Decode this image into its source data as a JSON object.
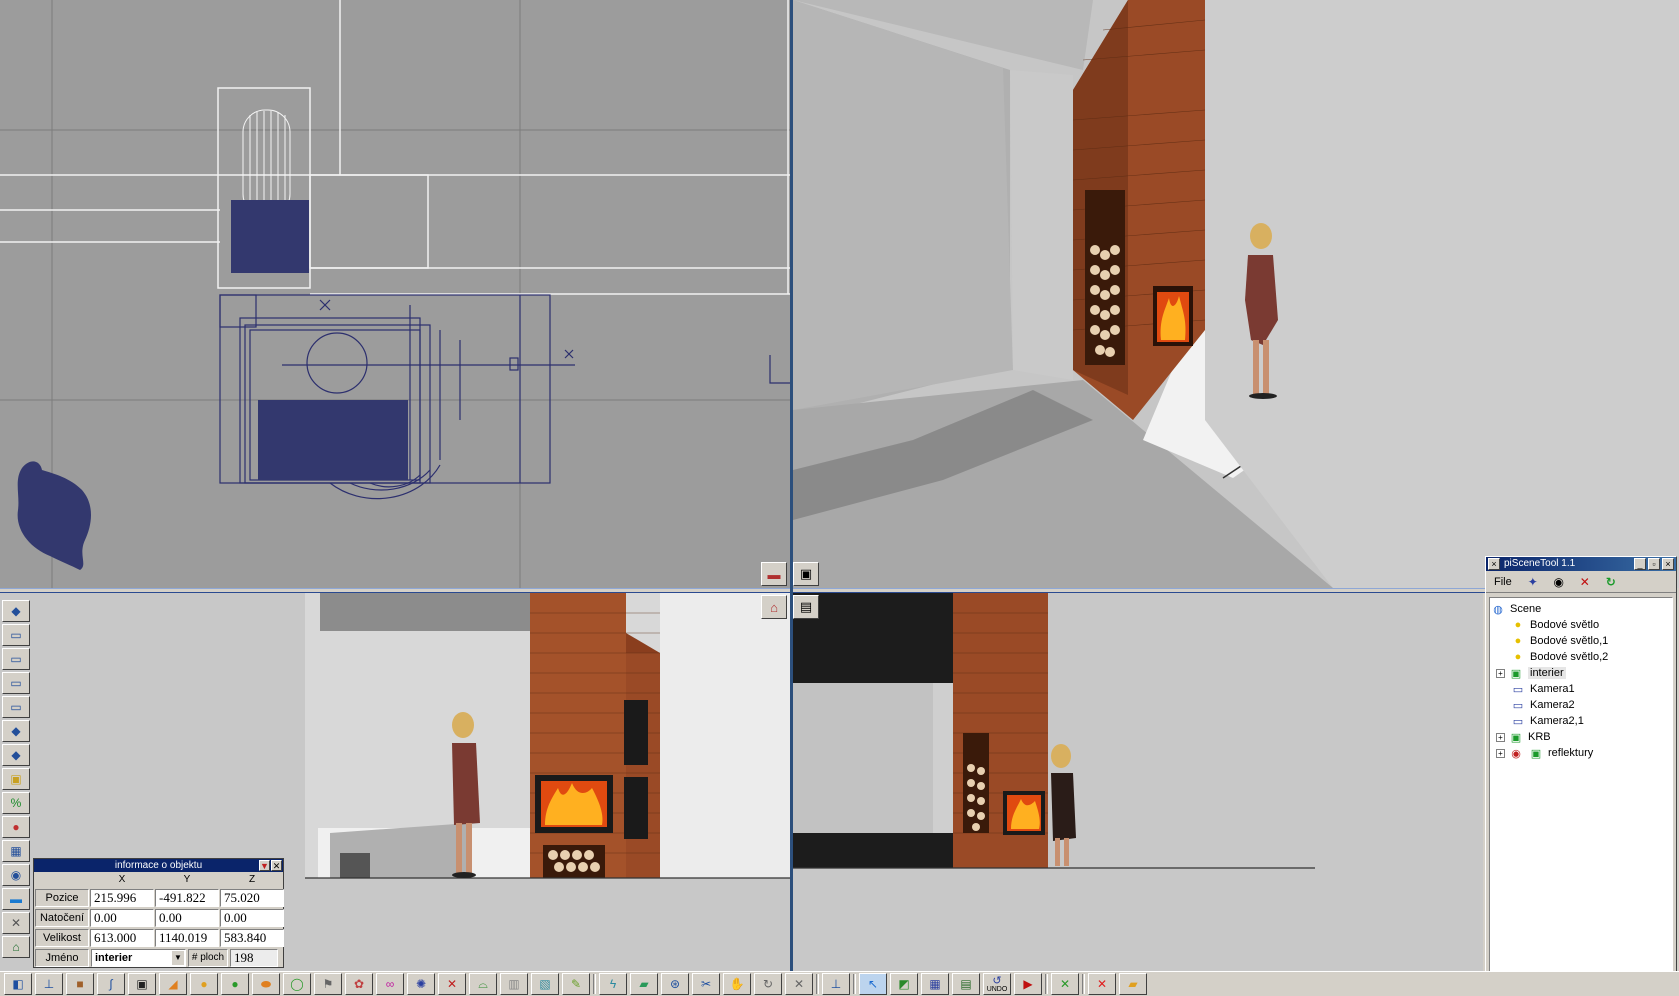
{
  "scene_tool": {
    "title": "piSceneTool 1.1",
    "close_left": "×",
    "minimize": "_",
    "restore": "▫",
    "close": "×",
    "file_menu": "File",
    "tree": [
      {
        "label": "Scene",
        "type": "scene",
        "level": 0,
        "expandable": false
      },
      {
        "label": "Bodové světlo",
        "type": "light",
        "level": 1,
        "expandable": false
      },
      {
        "label": "Bodové světlo,1",
        "type": "light",
        "level": 1,
        "expandable": false
      },
      {
        "label": "Bodové světlo,2",
        "type": "light",
        "level": 1,
        "expandable": false
      },
      {
        "label": "interier",
        "type": "group",
        "level": 1,
        "expandable": true,
        "selected": true
      },
      {
        "label": "Kamera1",
        "type": "camera",
        "level": 1,
        "expandable": false
      },
      {
        "label": "Kamera2",
        "type": "camera",
        "level": 1,
        "expandable": false
      },
      {
        "label": "Kamera2,1",
        "type": "camera",
        "level": 1,
        "expandable": false
      },
      {
        "label": "KRB",
        "type": "group",
        "level": 1,
        "expandable": true
      },
      {
        "label": "reflektury",
        "type": "group",
        "level": 1,
        "expandable": true
      }
    ]
  },
  "info_panel": {
    "title": "informace o objektu",
    "col_x": "X",
    "col_y": "Y",
    "col_z": "Z",
    "rows": [
      {
        "label": "Pozice",
        "x": "215.996",
        "y": "-491.822",
        "z": "75.020"
      },
      {
        "label": "Natočení",
        "x": "0.00",
        "y": "0.00",
        "z": "0.00"
      },
      {
        "label": "Velikost",
        "x": "613.000",
        "y": "1140.019",
        "z": "583.840"
      }
    ],
    "name_label": "Jméno",
    "name_value": "interier",
    "faces_label": "# ploch",
    "faces_value": "198"
  },
  "colors": {
    "wire": "#2c2f6e",
    "wire_fill": "#33386e",
    "brick": "#a4522a",
    "selection_border": "#2c4f7c"
  },
  "bottom_toolbar": {
    "undo_label": "UNDO"
  }
}
